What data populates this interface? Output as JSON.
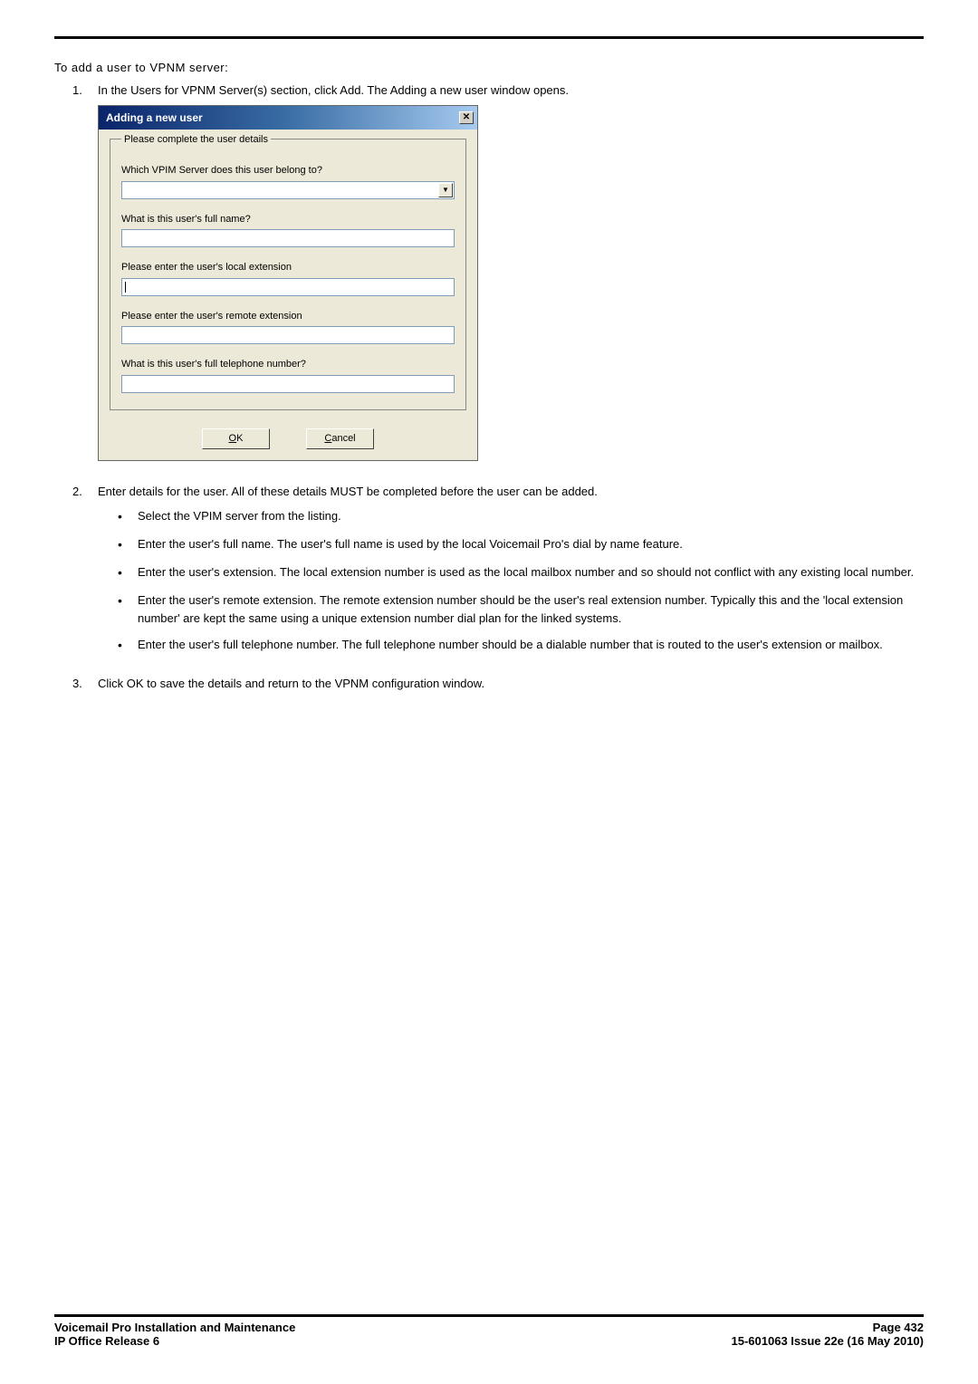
{
  "intro": "To add a user to VPNM server:",
  "steps": {
    "s1": {
      "num": "1.",
      "text": "In the Users for VPNM Server(s) section, click Add. The Adding a new user window opens."
    },
    "s2": {
      "num": "2.",
      "text": "Enter details for the user. All of these details MUST be completed before the user can be added.",
      "bullets": {
        "b1": "Select the VPIM server from the listing.",
        "b2": "Enter the user's full name. The user's full name is used by the local Voicemail Pro's dial by name feature.",
        "b3": "Enter the user's extension. The local extension number is used as the local mailbox number and so should not conflict with any existing local number.",
        "b4": "Enter the user's remote extension. The remote extension number should be the user's real extension number. Typically this and the 'local extension number' are kept the same using a unique extension number dial plan for the linked systems.",
        "b5": "Enter the user's full telephone number. The full telephone number should be a dialable number that is routed to the user's extension or mailbox."
      }
    },
    "s3": {
      "num": "3.",
      "text": "Click OK to save the details and return to the VPNM configuration window."
    }
  },
  "dialog": {
    "title": "Adding a new user",
    "legend": "Please complete the user details",
    "labels": {
      "server": "Which VPIM Server does this user belong to?",
      "fullname": "What is this user's full name?",
      "localext": "Please enter the user's local extension",
      "remoteext": "Please enter the user's remote extension",
      "phone": "What is this user's full telephone number?"
    },
    "values": {
      "server": "",
      "fullname": "",
      "localext": "",
      "remoteext": "",
      "phone": ""
    },
    "buttons": {
      "ok_pre": "",
      "ok_u": "O",
      "ok_post": "K",
      "cancel_pre": "",
      "cancel_u": "C",
      "cancel_post": "ancel"
    }
  },
  "footer": {
    "title": "Voicemail Pro Installation and Maintenance",
    "release": "IP Office Release 6",
    "page": "Page 432",
    "docid": "15-601063 Issue 22e (16 May 2010)"
  }
}
